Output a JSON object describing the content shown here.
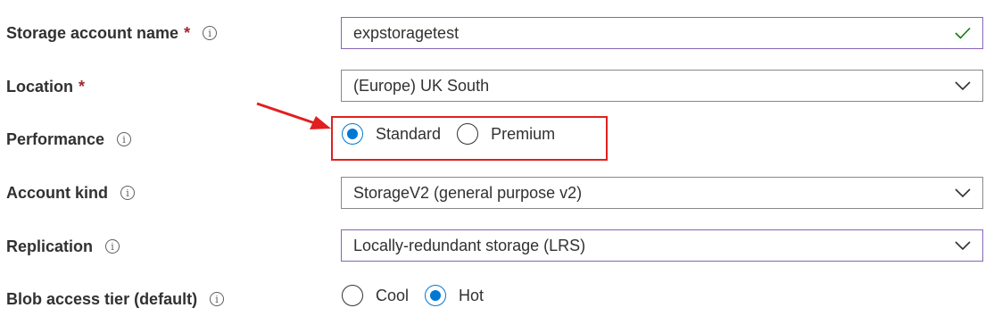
{
  "form": {
    "storage_account_name": {
      "label": "Storage account name",
      "required_mark": "*",
      "info_icon": "info-icon",
      "value": "expstoragetest",
      "valid_icon": "checkmark-icon",
      "valid_color": "#107c10"
    },
    "location": {
      "label": "Location",
      "required_mark": "*",
      "value": "(Europe) UK South"
    },
    "performance": {
      "label": "Performance",
      "options": [
        {
          "label": "Standard",
          "checked": true
        },
        {
          "label": "Premium",
          "checked": false
        }
      ]
    },
    "account_kind": {
      "label": "Account kind",
      "value": "StorageV2 (general purpose v2)"
    },
    "replication": {
      "label": "Replication",
      "value": "Locally-redundant storage (LRS)"
    },
    "blob_access_tier": {
      "label": "Blob access tier (default)",
      "options": [
        {
          "label": "Cool",
          "checked": false
        },
        {
          "label": "Hot",
          "checked": true
        }
      ]
    }
  },
  "colors": {
    "accent": "#0078d4",
    "annotation": "#e02020",
    "required": "#a4262c",
    "focus_border": "#8764b8"
  },
  "annotation": {
    "arrow_icon": "red-arrow-annotation",
    "box": "red-highlight-box"
  }
}
